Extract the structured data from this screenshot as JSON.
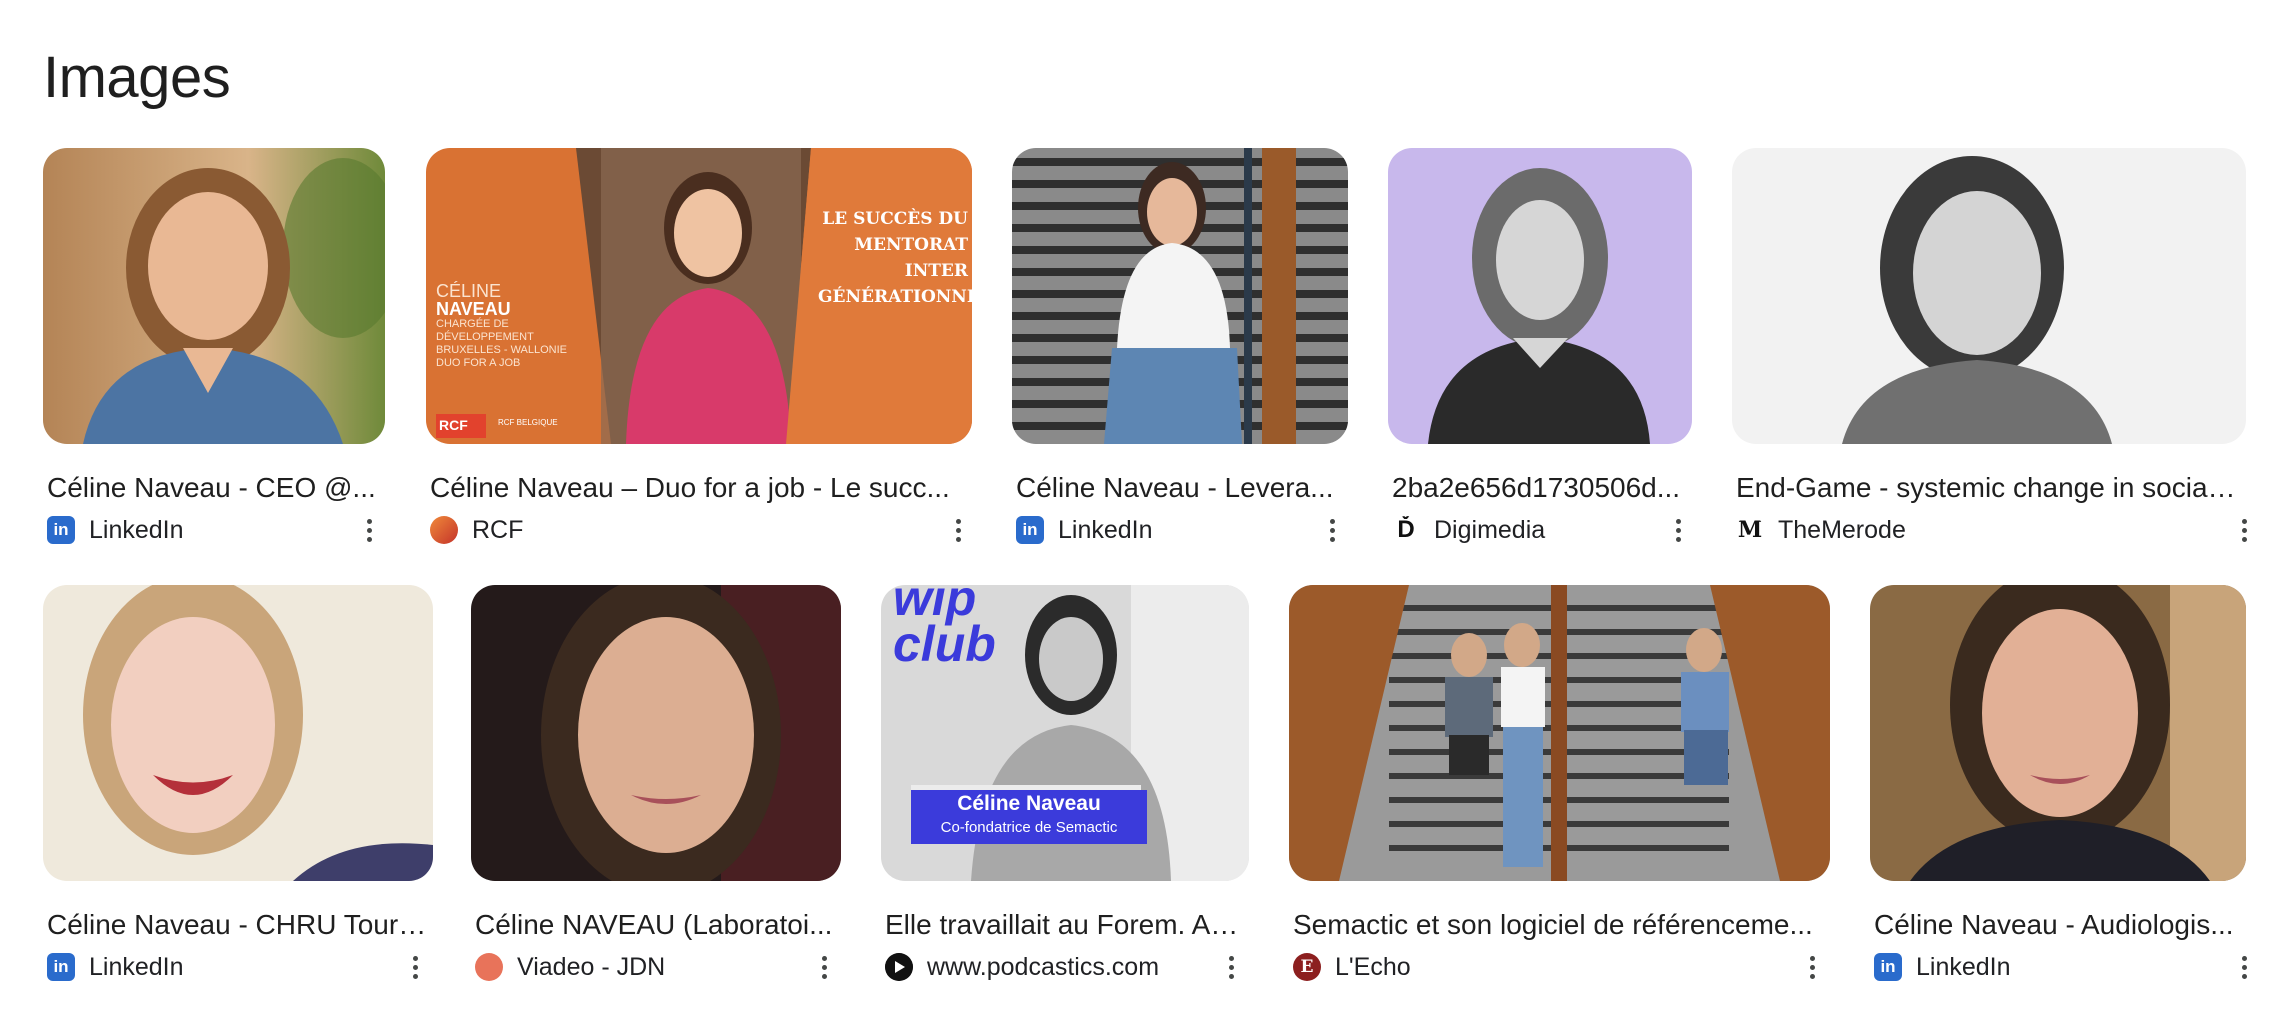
{
  "section": {
    "title": "Images"
  },
  "rows": [
    {
      "cards": [
        {
          "title": "Céline Naveau - CEO @...",
          "source": "LinkedIn",
          "favicon": "linkedin-icon"
        },
        {
          "title": "Céline Naveau – Duo for a job - Le succ...",
          "source": "RCF",
          "favicon": "rcf-icon",
          "image_text": {
            "name_first": "CÉLINE",
            "name_last": "NAVEAU",
            "role_1": "CHARGÉE DE",
            "role_2": "DÉVELOPPEMENT",
            "role_3": "BRUXELLES - WALLONIE",
            "role_4": "DUO FOR A JOB",
            "headline_1": "LE SUCCÈS DU",
            "headline_2": "MENTORAT",
            "headline_3": "INTER",
            "headline_4": "GÉNÉRATIONNEL",
            "logo": "RCF",
            "station": "RCF BELGIQUE"
          }
        },
        {
          "title": "Céline Naveau - Levera...",
          "source": "LinkedIn",
          "favicon": "linkedin-icon"
        },
        {
          "title": "2ba2e656d1730506d...",
          "source": "Digimedia",
          "favicon": "digimedia-icon"
        },
        {
          "title": "End-Game - systemic change in social ...",
          "source": "TheMerode",
          "favicon": "themerode-icon"
        }
      ]
    },
    {
      "cards": [
        {
          "title": "Céline Naveau - CHRU Tours...",
          "source": "LinkedIn",
          "favicon": "linkedin-icon"
        },
        {
          "title": "Céline NAVEAU (Laboratoi...",
          "source": "Viadeo - JDN",
          "favicon": "viadeo-icon"
        },
        {
          "title": "Elle travaillait au Forem. Au...",
          "source": "www.podcastics.com",
          "favicon": "podcastics-icon",
          "image_text": {
            "club_1": "wip",
            "club_2": "club",
            "caption_name": "Céline Naveau",
            "caption_role": "Co-fondatrice de Semactic"
          }
        },
        {
          "title": "Semactic et son logiciel de référenceme...",
          "source": "L'Echo",
          "favicon": "lecho-icon"
        },
        {
          "title": "Céline Naveau - Audiologis...",
          "source": "LinkedIn",
          "favicon": "linkedin-icon"
        }
      ]
    }
  ],
  "favicon_glyphs": {
    "linkedin": "in",
    "digimedia": "Ď",
    "themerode": "M",
    "lecho": "E"
  },
  "colors": {
    "text": "#1f1f1f",
    "linkedin": "#2a6bcc",
    "rcf_orange": "#e07a3a",
    "lilac": "#c8b8ec",
    "wip_blue": "#3b3bdb"
  }
}
